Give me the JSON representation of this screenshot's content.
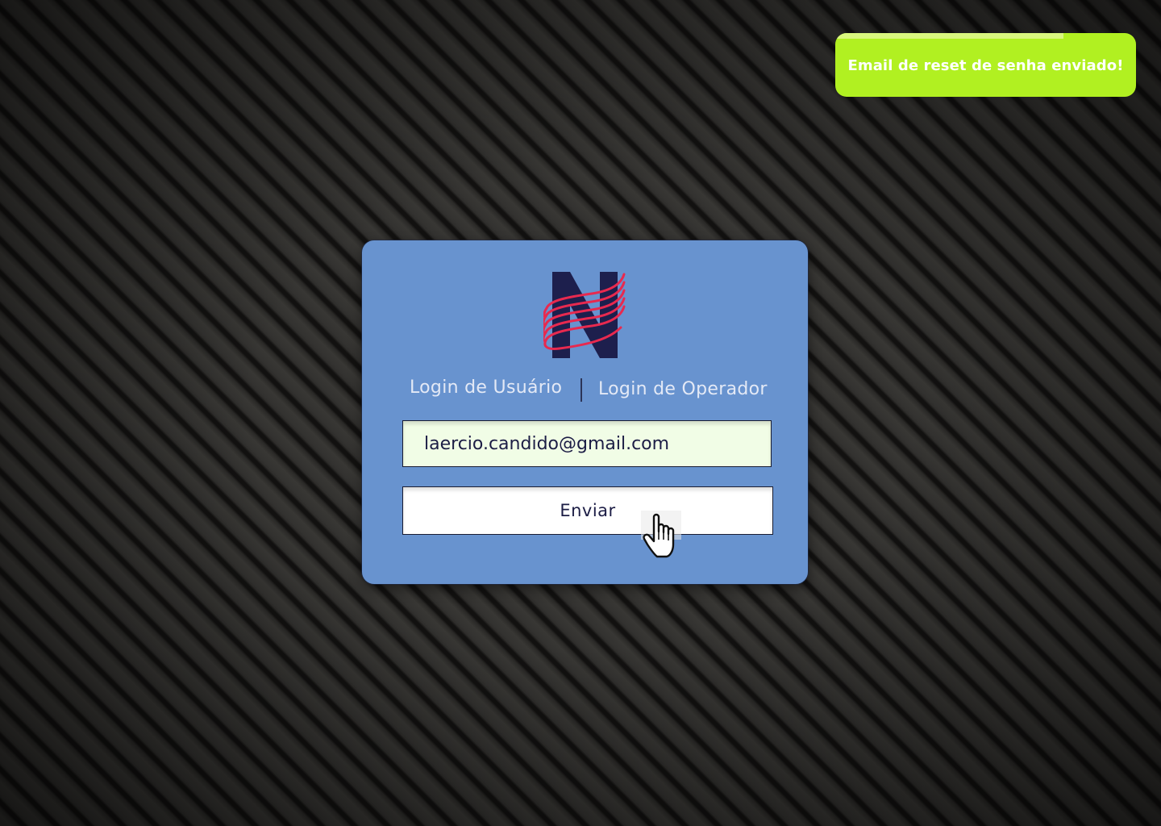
{
  "toast": {
    "message": "Email de reset de senha enviado!",
    "progress_fraction": 0.76,
    "color": "#b1f021"
  },
  "login_card": {
    "background_color": "#6893cf",
    "logo": {
      "letter": "N",
      "letter_color": "#1d1f4d",
      "accent_color": "#e8294f"
    },
    "tabs": [
      {
        "label": "Login de Usuário"
      },
      {
        "label": "Login de Operador"
      }
    ],
    "email_field": {
      "value": "laercio.candido@gmail.com"
    },
    "submit_label": "Enviar"
  },
  "cursor": {
    "icon": "hand-pointer-icon"
  }
}
